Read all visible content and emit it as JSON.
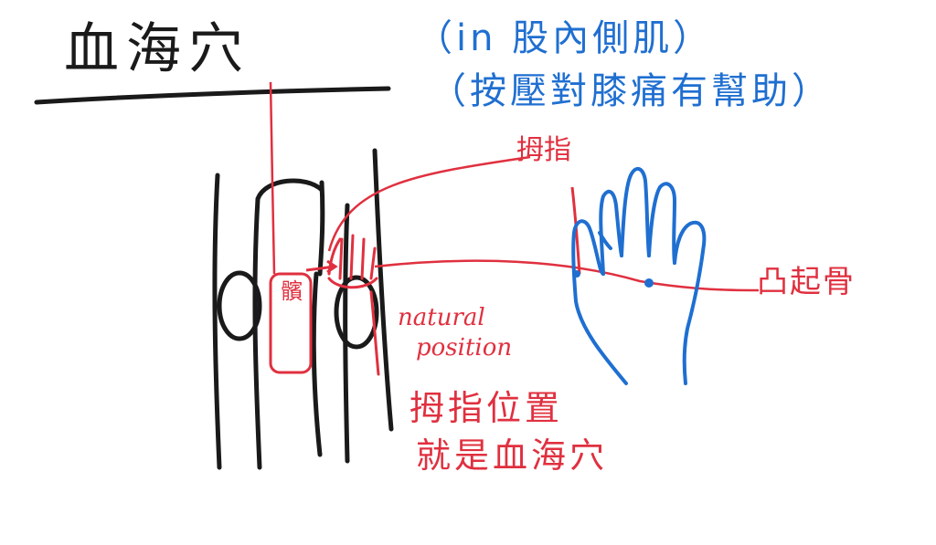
{
  "title": "血海穴",
  "notes": {
    "line1": "（in 股內側肌）",
    "line2": "（按壓對膝痛有幫助）"
  },
  "labels": {
    "thumb": "拇指",
    "bone": "凸起骨",
    "natural_1": "natural",
    "natural_2": "position",
    "position_1": "拇指位置",
    "position_2": "就是血海穴",
    "knee": "髕"
  },
  "colors": {
    "ink": "#1a1a1a",
    "blue": "#1f6fd1",
    "red": "#e0303f"
  }
}
